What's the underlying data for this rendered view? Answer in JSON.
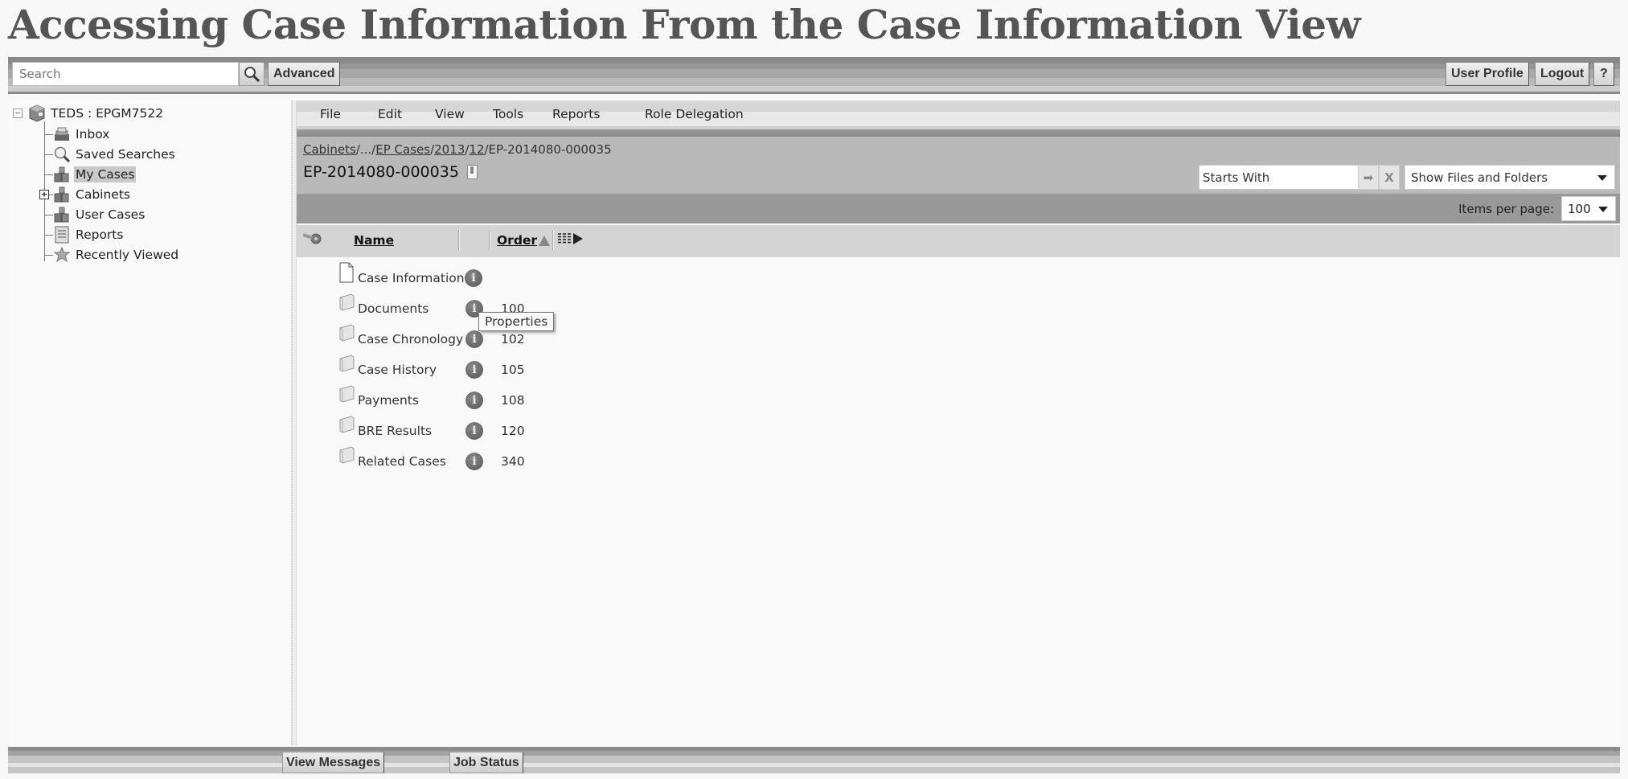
{
  "slide": {
    "title": "Accessing Case Information From the Case Information View"
  },
  "toolbar": {
    "search_placeholder": "Search",
    "advanced_label": "Advanced",
    "user_profile_label": "User Profile",
    "logout_label": "Logout",
    "help_label": "?"
  },
  "tree": {
    "root_label": "TEDS : EPGM7522",
    "root_toggle": "−",
    "items": [
      {
        "label": "Inbox",
        "icon": "inbox-icon"
      },
      {
        "label": "Saved Searches",
        "icon": "magnifier-icon"
      },
      {
        "label": "My Cases",
        "icon": "cases-icon",
        "selected": true
      },
      {
        "label": "Cabinets",
        "icon": "cabinets-icon",
        "expander": "+"
      },
      {
        "label": "User Cases",
        "icon": "cases-icon"
      },
      {
        "label": "Reports",
        "icon": "report-icon"
      },
      {
        "label": "Recently Viewed",
        "icon": "star-icon"
      }
    ]
  },
  "menu": {
    "items": [
      "File",
      "Edit",
      "View",
      "Tools",
      "Reports",
      "Role Delegation"
    ]
  },
  "breadcrumb": {
    "links": [
      "Cabinets",
      "...",
      "EP Cases",
      "2013",
      "12"
    ],
    "current": "EP-2014080-000035",
    "separator": "/"
  },
  "case": {
    "title": "EP-2014080-000035"
  },
  "filter": {
    "value": "Starts With",
    "go_icon": "➡",
    "clear_icon": "X",
    "show_selected": "Show Files and Folders"
  },
  "pager": {
    "label": "Items per page:",
    "selected": "100"
  },
  "columns": {
    "name": "Name",
    "order": "Order"
  },
  "rows": [
    {
      "name": "Case Information",
      "type": "document",
      "order": ""
    },
    {
      "name": "Documents",
      "type": "folder",
      "order": "100"
    },
    {
      "name": "Case Chronology",
      "type": "folder",
      "order": "102"
    },
    {
      "name": "Case History",
      "type": "folder",
      "order": "105"
    },
    {
      "name": "Payments",
      "type": "folder",
      "order": "108"
    },
    {
      "name": "BRE Results",
      "type": "folder",
      "order": "120"
    },
    {
      "name": "Related Cases",
      "type": "folder",
      "order": "340"
    }
  ],
  "tooltip": {
    "text": "Properties"
  },
  "info_glyph": "i",
  "footer": {
    "view_messages_label": "View Messages",
    "job_status_label": "Job Status"
  }
}
